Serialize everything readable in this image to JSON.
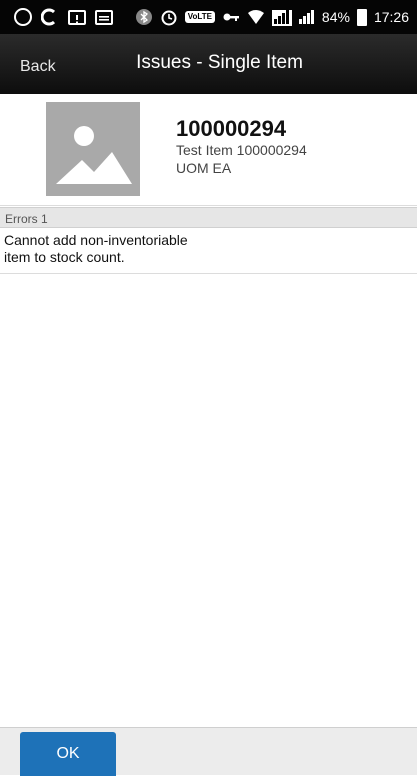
{
  "status_bar": {
    "battery": "84%",
    "time": "17:26",
    "volte": "VoLTE",
    "signal_1": "R",
    "icons": [
      "whatsapp-icon",
      "c-icon",
      "alert-icon",
      "message-icon",
      "bluetooth-icon",
      "alarm-icon",
      "volte-icon",
      "key-icon",
      "wifi-icon",
      "signal-icon",
      "signal-icon",
      "battery-icon"
    ]
  },
  "header": {
    "back_label": "Back",
    "title": "Issues - Single Item"
  },
  "item": {
    "number": "100000294",
    "description": "Test Item 100000294",
    "uom": "UOM EA",
    "image_icon": "image-placeholder-icon"
  },
  "errors": {
    "header_label": "Errors 1",
    "messages": [
      {
        "line1": "Cannot add non-inventoriable",
        "line2": "item to stock count."
      }
    ]
  },
  "footer": {
    "ok_label": "OK"
  },
  "colors": {
    "accent": "#1e72b8",
    "header_bg": "#1a1a1a",
    "section_bg": "#e6e6e6",
    "image_bg": "#a9a9a9"
  }
}
